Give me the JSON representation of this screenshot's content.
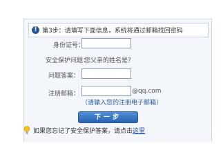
{
  "step_header": {
    "icon": "info-icon",
    "step": "第3步：",
    "text": "请填写下面信息，系统将通过邮箱找回密码"
  },
  "form": {
    "id_label": "身份证号：",
    "id_value": "",
    "security_question_label": "安全保护问题：",
    "security_question_value": "您父亲的姓名是？",
    "answer_label": "问题答案：",
    "answer_value": "",
    "email_label": "注册邮箱：",
    "email_value": "",
    "email_suffix": "@qq.com",
    "email_hint": "（请输入您的注册电子邮箱）"
  },
  "next_button": {
    "label": "下一步"
  },
  "footer": {
    "icon": "lightbulb-icon",
    "text": "如果您忘记了安全保护答案，请点击",
    "link": "这里"
  },
  "colors": {
    "accent": "#2a5a96",
    "link": "#1a4fa0",
    "panel_bg": "#f3f6fa"
  }
}
